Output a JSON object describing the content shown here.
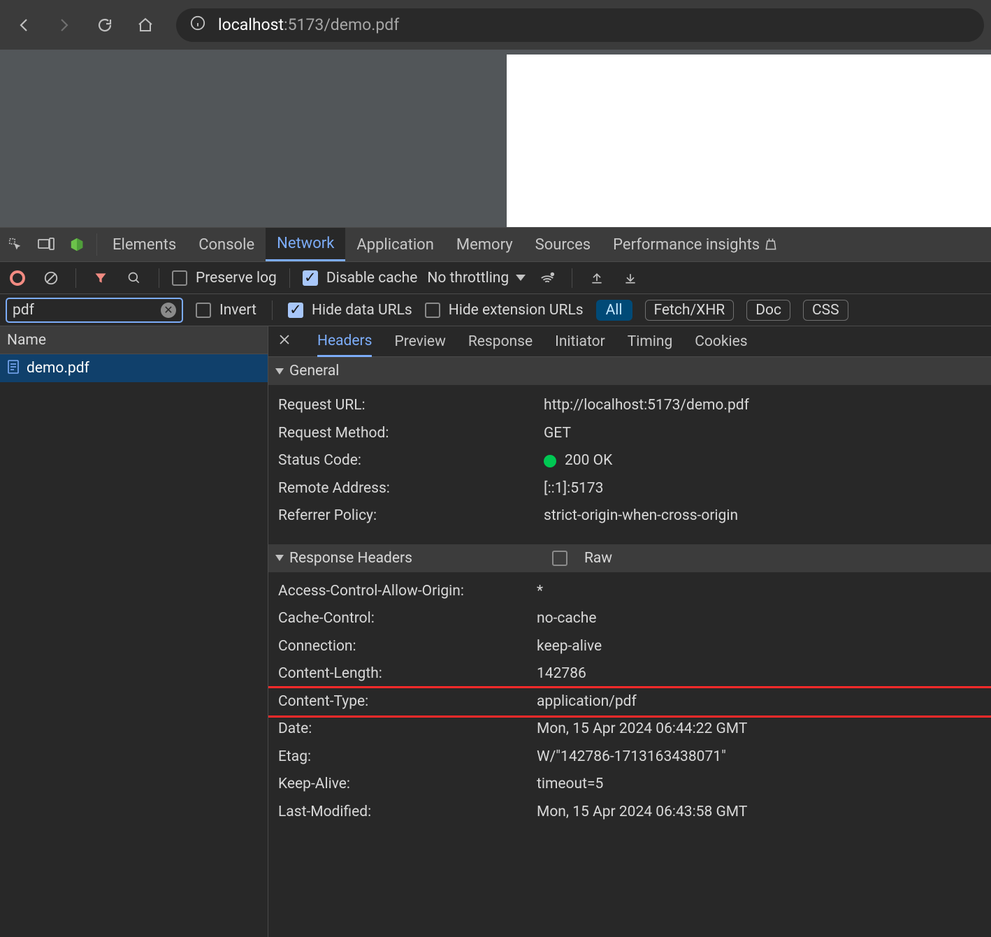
{
  "url": {
    "host_strong": "localhost",
    "host_weak": ":5173/demo.pdf"
  },
  "devtools_tabs": {
    "elements": "Elements",
    "console": "Console",
    "network": "Network",
    "application": "Application",
    "memory": "Memory",
    "sources": "Sources",
    "performance_insights": "Performance insights"
  },
  "toolbar": {
    "preserve_log": "Preserve log",
    "disable_cache": "Disable cache",
    "throttling": "No throttling"
  },
  "filterbar": {
    "filter_value": "pdf",
    "invert": "Invert",
    "hide_data_urls": "Hide data URLs",
    "hide_extension_urls": "Hide extension URLs",
    "all": "All",
    "fetch_xhr": "Fetch/XHR",
    "doc": "Doc",
    "css": "CSS"
  },
  "left": {
    "header_name": "Name",
    "request_name": "demo.pdf"
  },
  "right_tabs": {
    "headers": "Headers",
    "preview": "Preview",
    "response": "Response",
    "initiator": "Initiator",
    "timing": "Timing",
    "cookies": "Cookies"
  },
  "general": {
    "title": "General",
    "request_url_label": "Request URL:",
    "request_url_value": "http://localhost:5173/demo.pdf",
    "request_method_label": "Request Method:",
    "request_method_value": "GET",
    "status_code_label": "Status Code:",
    "status_code_value": "200 OK",
    "remote_address_label": "Remote Address:",
    "remote_address_value": "[::1]:5173",
    "referrer_policy_label": "Referrer Policy:",
    "referrer_policy_value": "strict-origin-when-cross-origin"
  },
  "response_headers": {
    "title": "Response Headers",
    "raw": "Raw",
    "items": [
      {
        "k": "Access-Control-Allow-Origin:",
        "v": "*"
      },
      {
        "k": "Cache-Control:",
        "v": "no-cache"
      },
      {
        "k": "Connection:",
        "v": "keep-alive"
      },
      {
        "k": "Content-Length:",
        "v": "142786"
      },
      {
        "k": "Content-Type:",
        "v": "application/pdf"
      },
      {
        "k": "Date:",
        "v": "Mon, 15 Apr 2024 06:44:22 GMT"
      },
      {
        "k": "Etag:",
        "v": "W/\"142786-1713163438071\""
      },
      {
        "k": "Keep-Alive:",
        "v": "timeout=5"
      },
      {
        "k": "Last-Modified:",
        "v": "Mon, 15 Apr 2024 06:43:58 GMT"
      }
    ]
  }
}
